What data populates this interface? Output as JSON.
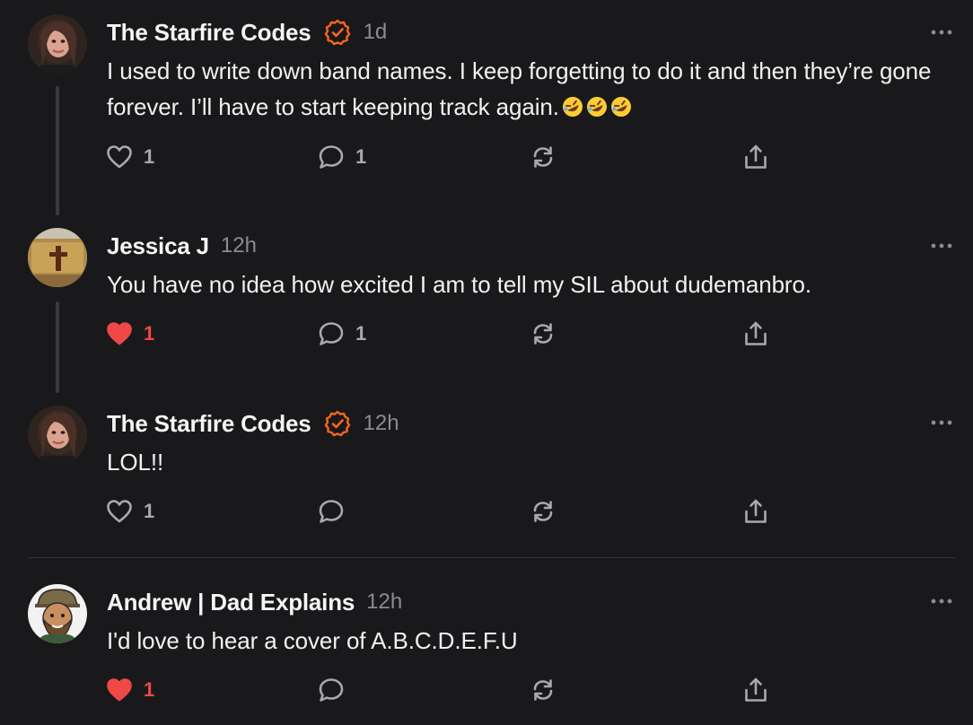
{
  "colors": {
    "background": "#19191b",
    "text": "#f1f1f1",
    "muted": "#8b8b90",
    "verified": "#ff6719",
    "liked": "#f04747",
    "icon": "#a9a9ad"
  },
  "comments": [
    {
      "author": "The Starfire Codes",
      "verified": true,
      "time": "1d",
      "text": "I used to write down band names. I keep forgetting to do it and then they’re gone forever. I’ll have to start keeping track again.",
      "emoji": [
        "rolling-on-floor-laughing",
        "rolling-on-floor-laughing",
        "rolling-on-floor-laughing"
      ],
      "likes": "1",
      "liked": false,
      "replies": "1",
      "avatar": "starfire-avatar"
    },
    {
      "author": "Jessica J",
      "verified": false,
      "time": "12h",
      "text": "You have no idea how excited I am to tell my SIL about dudemanbro.",
      "likes": "1",
      "liked": true,
      "replies": "1",
      "avatar": "cross-avatar"
    },
    {
      "author": "The Starfire Codes",
      "verified": true,
      "time": "12h",
      "text": "LOL!!",
      "likes": "1",
      "liked": false,
      "replies": "",
      "avatar": "starfire-avatar"
    },
    {
      "author": "Andrew | Dad Explains",
      "verified": false,
      "time": "12h",
      "text": "I'd love to hear a cover of A.B.C.D.E.F.U",
      "likes": "1",
      "liked": true,
      "replies": "",
      "avatar": "cartoon-man-avatar"
    }
  ],
  "icons": {
    "like": "heart-icon",
    "reply": "comment-bubble-icon",
    "restack": "restack-icon",
    "share": "share-icon",
    "more": "more-dots-icon",
    "verified": "verified-badge-icon"
  }
}
